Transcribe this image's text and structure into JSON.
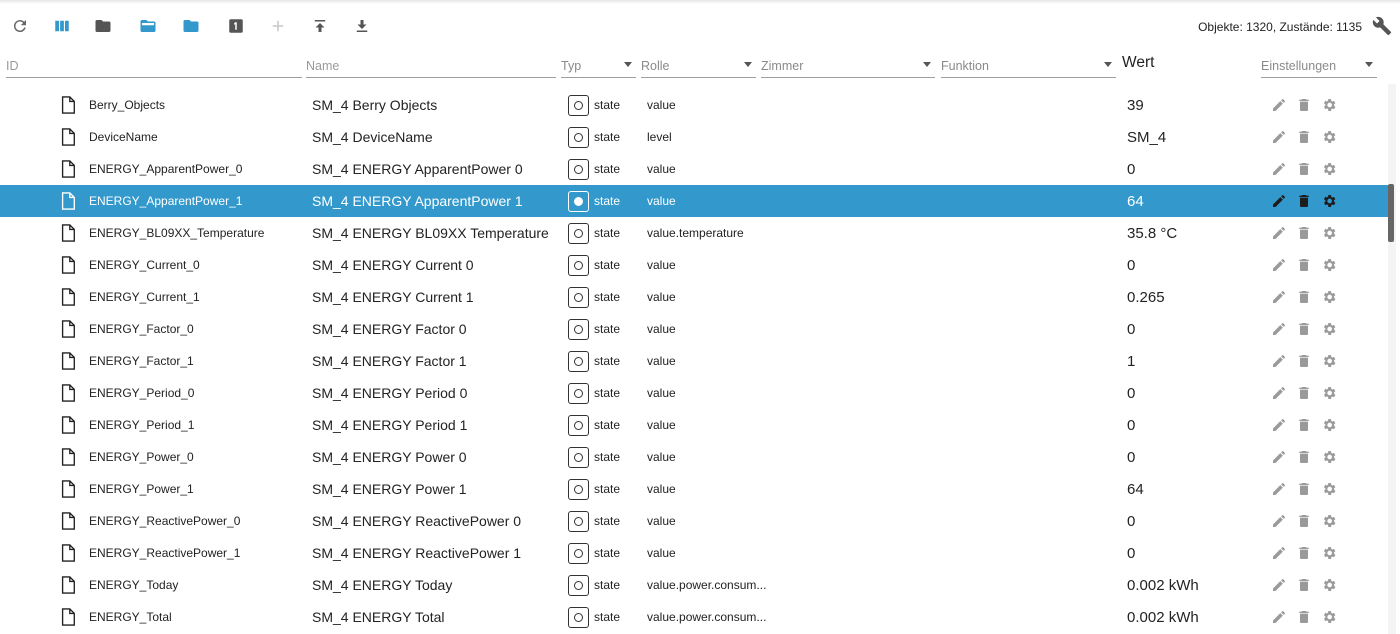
{
  "toolbar": {
    "stats": "Objekte: 1320, Zustände: 1135",
    "icons": [
      "refresh-icon",
      "columns-icon",
      "folder-icon",
      "folder-open-icon",
      "folder-blue-icon",
      "number-1-icon",
      "add-icon",
      "upload-icon",
      "download-icon",
      "wrench-icon"
    ]
  },
  "filters": {
    "id_placeholder": "ID",
    "name_placeholder": "Name",
    "typ_label": "Typ",
    "rolle_label": "Rolle",
    "zimmer_label": "Zimmer",
    "funktion_label": "Funktion",
    "wert_label": "Wert",
    "settings_label": "Einstellungen"
  },
  "colors": {
    "selected_row": "#3399cc",
    "accent": "#3399cc"
  },
  "rows": [
    {
      "id": "Berry_Objects",
      "name": "SM_4 Berry Objects",
      "typ": "state",
      "rolle": "value",
      "wert": "39"
    },
    {
      "id": "DeviceName",
      "name": "SM_4 DeviceName",
      "typ": "state",
      "rolle": "level",
      "wert": "SM_4"
    },
    {
      "id": "ENERGY_ApparentPower_0",
      "name": "SM_4 ENERGY ApparentPower 0",
      "typ": "state",
      "rolle": "value",
      "wert": "0"
    },
    {
      "id": "ENERGY_ApparentPower_1",
      "name": "SM_4 ENERGY ApparentPower 1",
      "typ": "state",
      "rolle": "value",
      "wert": "64",
      "selected": true
    },
    {
      "id": "ENERGY_BL09XX_Temperature",
      "name": "SM_4 ENERGY BL09XX Temperature",
      "typ": "state",
      "rolle": "value.temperature",
      "wert": "35.8 °C"
    },
    {
      "id": "ENERGY_Current_0",
      "name": "SM_4 ENERGY Current 0",
      "typ": "state",
      "rolle": "value",
      "wert": "0"
    },
    {
      "id": "ENERGY_Current_1",
      "name": "SM_4 ENERGY Current 1",
      "typ": "state",
      "rolle": "value",
      "wert": "0.265"
    },
    {
      "id": "ENERGY_Factor_0",
      "name": "SM_4 ENERGY Factor 0",
      "typ": "state",
      "rolle": "value",
      "wert": "0"
    },
    {
      "id": "ENERGY_Factor_1",
      "name": "SM_4 ENERGY Factor 1",
      "typ": "state",
      "rolle": "value",
      "wert": "1"
    },
    {
      "id": "ENERGY_Period_0",
      "name": "SM_4 ENERGY Period 0",
      "typ": "state",
      "rolle": "value",
      "wert": "0"
    },
    {
      "id": "ENERGY_Period_1",
      "name": "SM_4 ENERGY Period 1",
      "typ": "state",
      "rolle": "value",
      "wert": "0"
    },
    {
      "id": "ENERGY_Power_0",
      "name": "SM_4 ENERGY Power 0",
      "typ": "state",
      "rolle": "value",
      "wert": "0"
    },
    {
      "id": "ENERGY_Power_1",
      "name": "SM_4 ENERGY Power 1",
      "typ": "state",
      "rolle": "value",
      "wert": "64"
    },
    {
      "id": "ENERGY_ReactivePower_0",
      "name": "SM_4 ENERGY ReactivePower 0",
      "typ": "state",
      "rolle": "value",
      "wert": "0"
    },
    {
      "id": "ENERGY_ReactivePower_1",
      "name": "SM_4 ENERGY ReactivePower 1",
      "typ": "state",
      "rolle": "value",
      "wert": "0"
    },
    {
      "id": "ENERGY_Today",
      "name": "SM_4 ENERGY Today",
      "typ": "state",
      "rolle": "value.power.consum...",
      "wert": "0.002 kWh"
    },
    {
      "id": "ENERGY_Total",
      "name": "SM_4 ENERGY Total",
      "typ": "state",
      "rolle": "value.power.consum...",
      "wert": "0.002 kWh"
    }
  ]
}
